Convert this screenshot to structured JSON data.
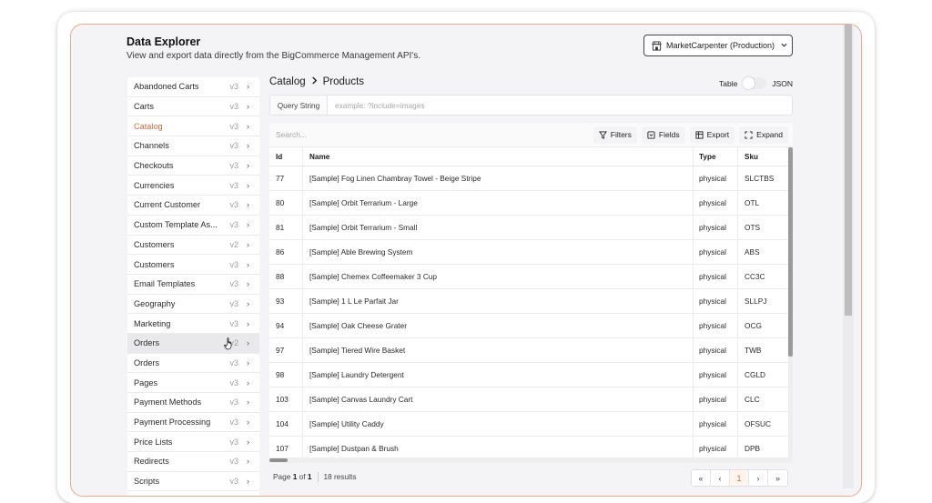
{
  "header": {
    "title": "Data Explorer",
    "subtitle": "View and export data directly from the BigCommerce Management API's.",
    "store_selector": {
      "label": "MarketCarpenter (Production)",
      "icon": "store-icon",
      "chevron": "⌄"
    }
  },
  "sidebar": {
    "items": [
      {
        "label": "Abandoned Carts",
        "version": "v3",
        "active": false
      },
      {
        "label": "Carts",
        "version": "v3",
        "active": false
      },
      {
        "label": "Catalog",
        "version": "v3",
        "active": true
      },
      {
        "label": "Channels",
        "version": "v3",
        "active": false
      },
      {
        "label": "Checkouts",
        "version": "v3",
        "active": false
      },
      {
        "label": "Currencies",
        "version": "v3",
        "active": false
      },
      {
        "label": "Current Customer",
        "version": "v3",
        "active": false
      },
      {
        "label": "Custom Template As...",
        "version": "v3",
        "active": false
      },
      {
        "label": "Customers",
        "version": "v2",
        "active": false
      },
      {
        "label": "Customers",
        "version": "v3",
        "active": false
      },
      {
        "label": "Email Templates",
        "version": "v3",
        "active": false
      },
      {
        "label": "Geography",
        "version": "v3",
        "active": false
      },
      {
        "label": "Marketing",
        "version": "v3",
        "active": false
      },
      {
        "label": "Orders",
        "version": "v2",
        "active": false,
        "hovered": true
      },
      {
        "label": "Orders",
        "version": "v3",
        "active": false
      },
      {
        "label": "Pages",
        "version": "v3",
        "active": false
      },
      {
        "label": "Payment Methods",
        "version": "v3",
        "active": false
      },
      {
        "label": "Payment Processing",
        "version": "v3",
        "active": false
      },
      {
        "label": "Price Lists",
        "version": "v3",
        "active": false
      },
      {
        "label": "Redirects",
        "version": "v3",
        "active": false
      },
      {
        "label": "Scripts",
        "version": "v3",
        "active": false
      }
    ],
    "chevron": "›"
  },
  "main": {
    "breadcrumb": {
      "parent": "Catalog",
      "separator": ">",
      "current": "Products"
    },
    "view_toggle": {
      "left_label": "Table",
      "right_label": "JSON",
      "selected": "Table"
    },
    "query": {
      "label": "Query String",
      "value": "",
      "placeholder": "example: ?include=images"
    },
    "toolbar": {
      "search_placeholder": "Search...",
      "search_value": "",
      "buttons": [
        {
          "label": "Filters",
          "icon": "filter-icon"
        },
        {
          "label": "Fields",
          "icon": "fields-icon"
        },
        {
          "label": "Export",
          "icon": "export-icon"
        },
        {
          "label": "Expand",
          "icon": "expand-icon"
        }
      ]
    },
    "table": {
      "columns": [
        "Id",
        "Name",
        "Type",
        "Sku"
      ],
      "rows": [
        {
          "id": "77",
          "name": "[Sample] Fog Linen Chambray Towel - Beige Stripe",
          "type": "physical",
          "sku": "SLCTBS"
        },
        {
          "id": "80",
          "name": "[Sample] Orbit Terrarium - Large",
          "type": "physical",
          "sku": "OTL"
        },
        {
          "id": "81",
          "name": "[Sample] Orbit Terrarium - Small",
          "type": "physical",
          "sku": "OTS"
        },
        {
          "id": "86",
          "name": "[Sample] Able Brewing System",
          "type": "physical",
          "sku": "ABS"
        },
        {
          "id": "88",
          "name": "[Sample] Chemex Coffeemaker 3 Cup",
          "type": "physical",
          "sku": "CC3C"
        },
        {
          "id": "93",
          "name": "[Sample] 1 L Le Parfait Jar",
          "type": "physical",
          "sku": "SLLPJ"
        },
        {
          "id": "94",
          "name": "[Sample] Oak Cheese Grater",
          "type": "physical",
          "sku": "OCG"
        },
        {
          "id": "97",
          "name": "[Sample] Tiered Wire Basket",
          "type": "physical",
          "sku": "TWB"
        },
        {
          "id": "98",
          "name": "[Sample] Laundry Detergent",
          "type": "physical",
          "sku": "CGLD"
        },
        {
          "id": "103",
          "name": "[Sample] Canvas Laundry Cart",
          "type": "physical",
          "sku": "CLC"
        },
        {
          "id": "104",
          "name": "[Sample] Utility Caddy",
          "type": "physical",
          "sku": "OFSUC"
        },
        {
          "id": "107",
          "name": "[Sample] Dustpan & Brush",
          "type": "physical",
          "sku": "DPB"
        }
      ]
    },
    "footer": {
      "page_prefix": "Page",
      "current_page": "1",
      "of_label": "of",
      "total_pages": "1",
      "results": "18 results",
      "pager": {
        "first": "«",
        "prev": "‹",
        "current": "1",
        "next": "›",
        "last": "»"
      }
    }
  },
  "colors": {
    "accent": "#e0693f",
    "frame_border": "#f0a98c",
    "background": "#f4f4f7"
  }
}
